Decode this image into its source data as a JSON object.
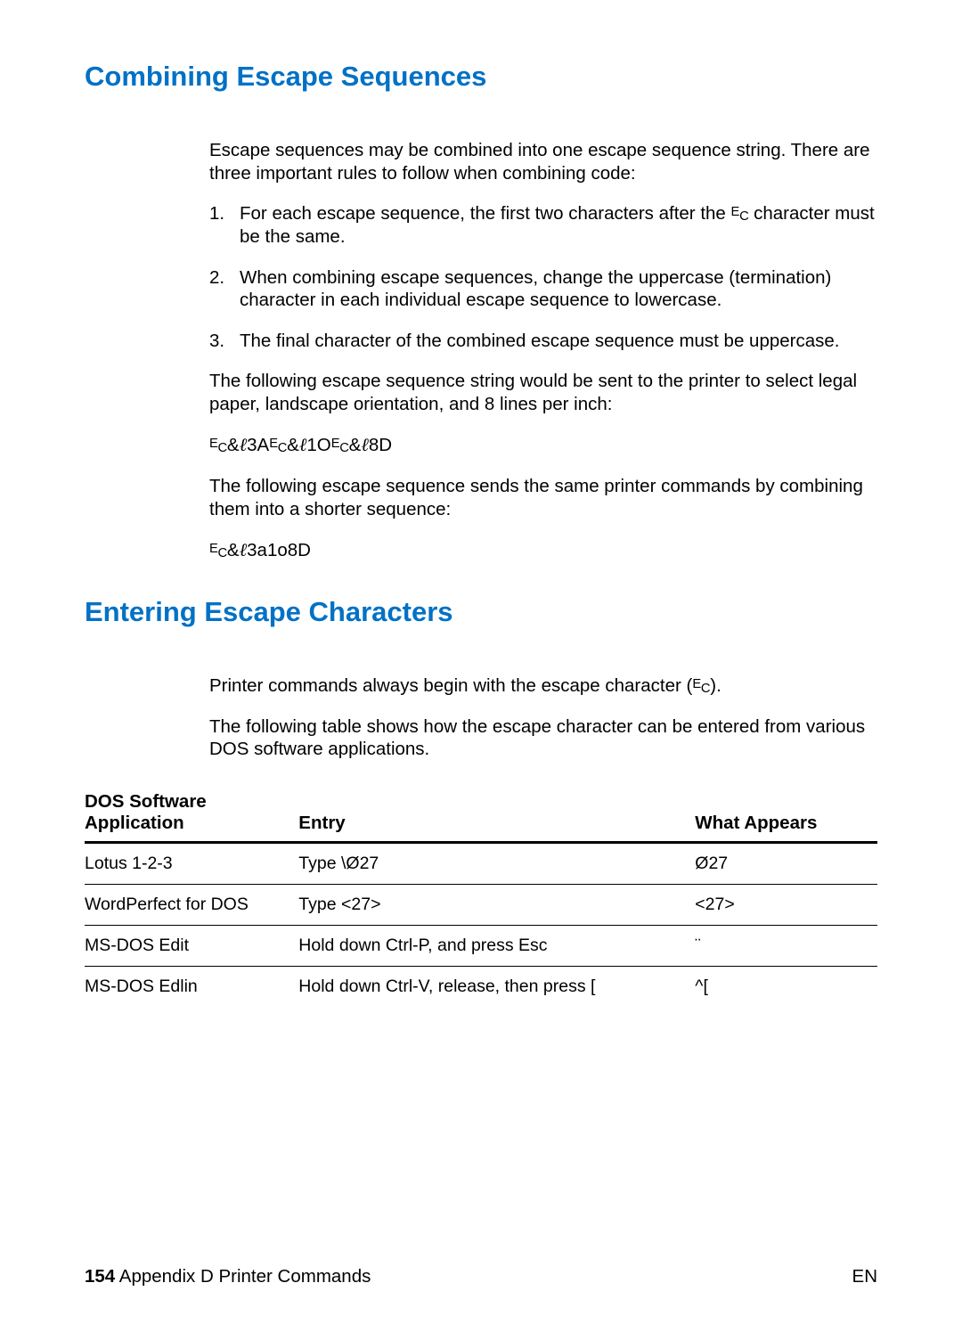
{
  "sections": {
    "combining": {
      "title": "Combining Escape Sequences",
      "intro": "Escape sequences may be combined into one escape sequence string. There are three important rules to follow when combining code:",
      "rules": [
        {
          "before_ec": "For each escape sequence, the first two characters after the ",
          "after_ec": " character must be the same."
        },
        {
          "text": "When combining escape sequences, change the uppercase (termination) character in each individual escape sequence to lowercase."
        },
        {
          "text": "The final character of the combined escape sequence must be uppercase."
        }
      ],
      "para2": "The following escape sequence string would be sent to the printer to select legal paper, landscape orientation, and 8 lines per inch:",
      "seq_parts": {
        "a": "&",
        "b": "3A",
        "c": "&",
        "d": "1O",
        "e": "&",
        "f": "8D"
      },
      "para3": "The following escape sequence sends the same printer commands by combining them into a shorter sequence:",
      "seq2_a": "&",
      "seq2_b": "3a1o8D"
    },
    "entering": {
      "title": "Entering Escape Characters",
      "p1a": "Printer commands always begin with the escape character (",
      "p1b": ").",
      "p2": "The following table shows how the escape character can be entered from various DOS software applications."
    }
  },
  "table": {
    "headers": {
      "c1a": "DOS Software",
      "c1b": "Application",
      "c2": "Entry",
      "c3": "What Appears"
    },
    "rows": [
      {
        "app": "Lotus 1-2-3",
        "entry": "Type \\Ø27",
        "appears": "Ø27"
      },
      {
        "app": "WordPerfect for DOS",
        "entry": "Type <27>",
        "appears": "<27>"
      },
      {
        "app": "MS-DOS Edit",
        "entry": "Hold down Ctrl-P, and press Esc",
        "appears": "¨"
      },
      {
        "app": "MS-DOS Edlin",
        "entry": "Hold down Ctrl-V, release, then press [",
        "appears": "^["
      }
    ]
  },
  "footer": {
    "page_num": "154",
    "section": " Appendix D Printer Commands",
    "lang": "EN"
  }
}
